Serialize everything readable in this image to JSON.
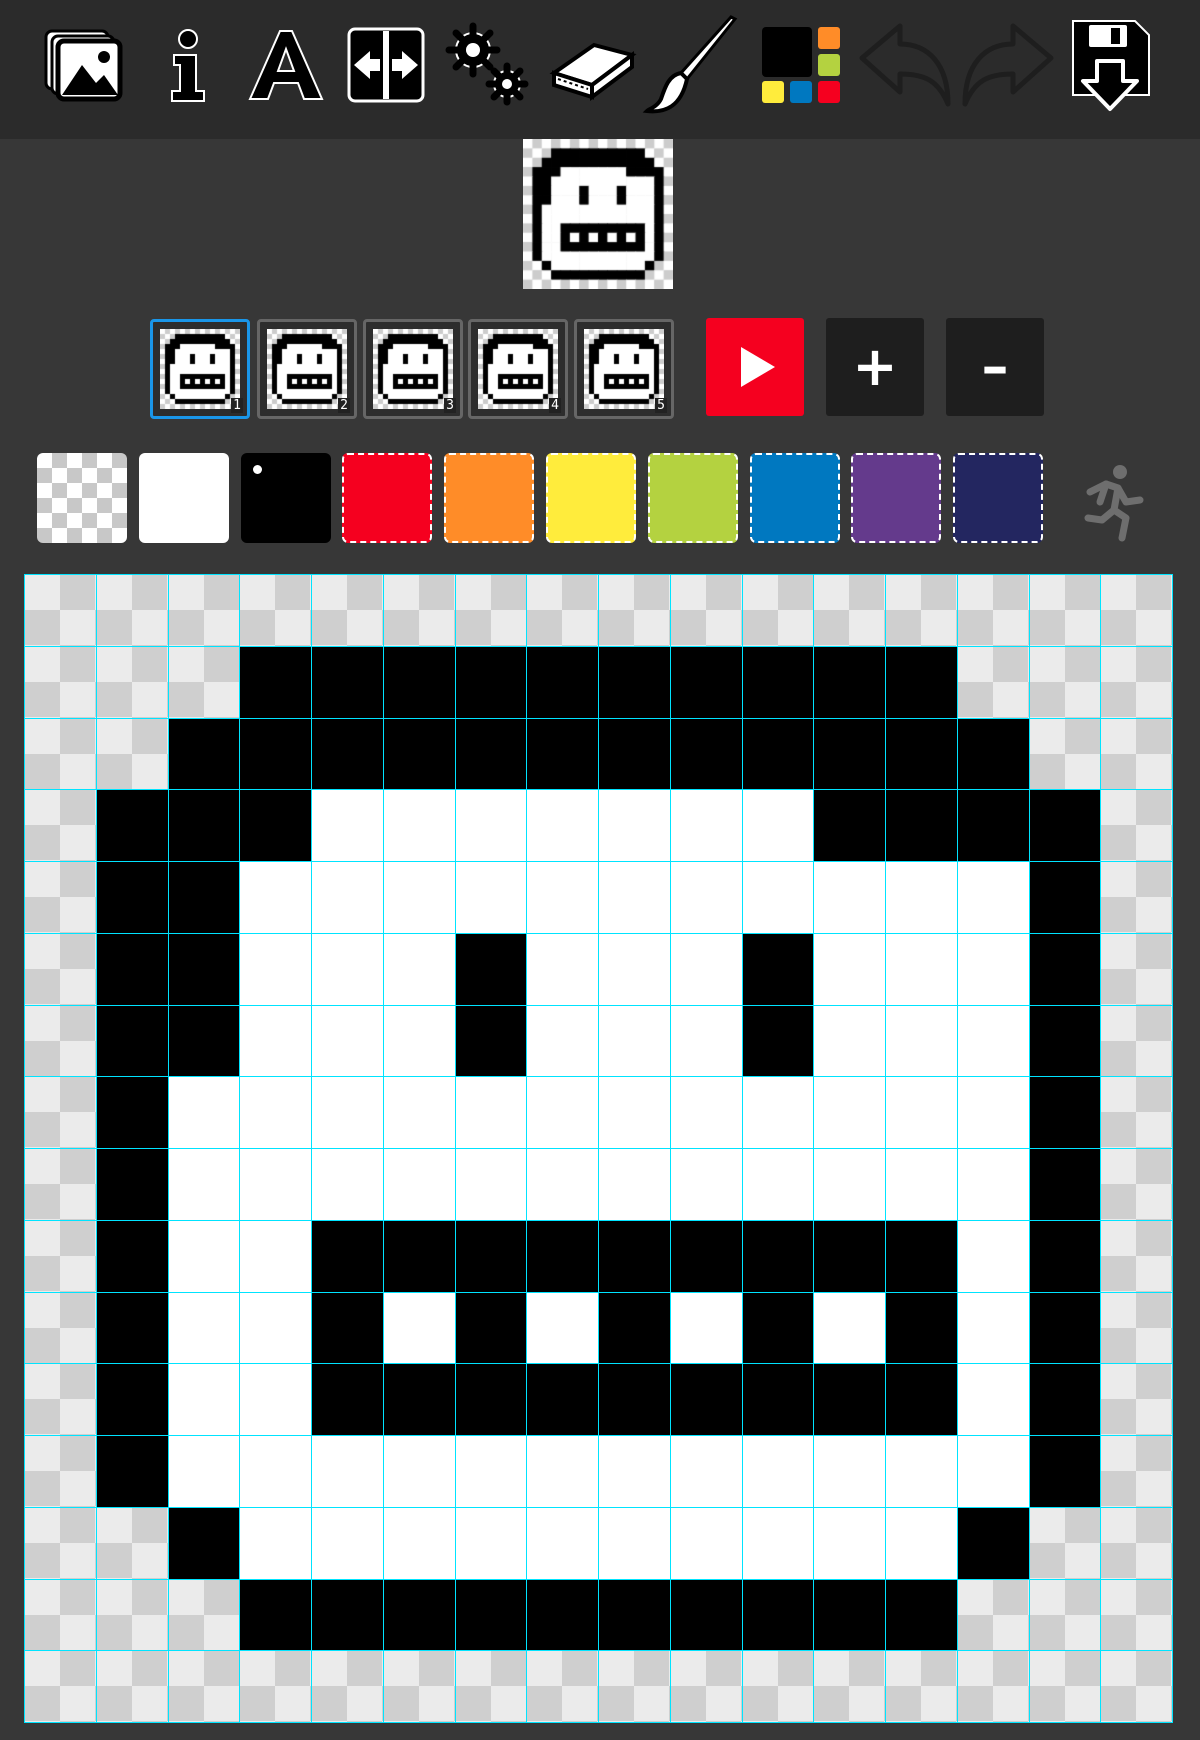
{
  "toolbar": {
    "tools": [
      {
        "name": "gallery-icon"
      },
      {
        "name": "info-icon"
      },
      {
        "name": "text-icon"
      },
      {
        "name": "flip-icon"
      },
      {
        "name": "settings-icon"
      },
      {
        "name": "eraser-icon"
      },
      {
        "name": "brush-icon"
      },
      {
        "name": "palette-icon"
      },
      {
        "name": "undo-icon"
      },
      {
        "name": "redo-icon"
      },
      {
        "name": "save-icon"
      }
    ]
  },
  "frames": {
    "selected_index": 0,
    "labels": [
      "1",
      "2",
      "3",
      "4",
      "5"
    ]
  },
  "controls": {
    "add_label": "+",
    "remove_label": "–"
  },
  "palette": {
    "colors": [
      "transparent",
      "#ffffff",
      "#000000",
      "#f5001f",
      "#ff8c28",
      "#ffec3c",
      "#b4d240",
      "#0078c0",
      "#643a8c",
      "#232660"
    ],
    "selected_index": 2
  },
  "pixel_art": {
    "rows": [
      "tttttttttttttttt",
      "tttbbbbbbbbbbttt",
      "ttbbbbbbbbbbbbtt",
      "tbbbwwwwwwwbbbbt",
      "tbbwwwwwwwwwwwbt",
      "tbbwwwbwwwbwwwbt",
      "tbbwwwbwwwbwwwbt",
      "tbwwwwwwwwwwwwbt",
      "tbwwwwwwwwwwwwbt",
      "tbwwbbbbbbbbbwbt",
      "tbwwbwbwbwbwbwbt",
      "tbwwbbbbbbbbbwbt",
      "tbwwwwwwwwwwwwbt",
      "ttbwwwwwwwwwwbtt",
      "tttbbbbbbbbbbttt",
      "tttttttttttttttt"
    ]
  }
}
